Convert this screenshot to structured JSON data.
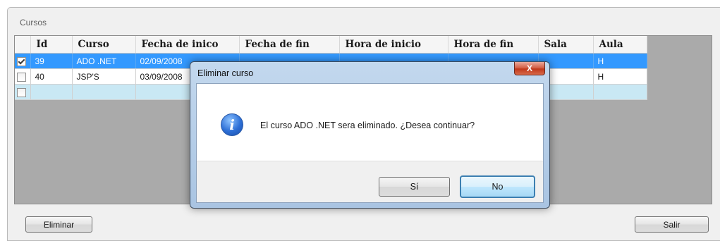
{
  "window": {
    "group_label": "Cursos"
  },
  "table": {
    "columns": [
      "Id",
      "Curso",
      "Fecha de inico",
      "Fecha de fin",
      "Hora de inicio",
      "Hora de fin",
      "Sala",
      "Aula"
    ],
    "rows": [
      {
        "checked": true,
        "id": "39",
        "curso": "ADO .NET",
        "fecha_inicio": "02/09/2008",
        "aula": "H",
        "selected": true
      },
      {
        "checked": false,
        "id": "40",
        "curso": "JSP'S",
        "fecha_inicio": "03/09/2008",
        "aula": "H",
        "selected": false
      }
    ]
  },
  "buttons": {
    "eliminar": "Eliminar",
    "salir": "Salir"
  },
  "dialog": {
    "title": "Eliminar curso",
    "close_glyph": "X",
    "icon": "info-icon",
    "icon_glyph": "i",
    "message": "El curso ADO .NET sera eliminado. ¿Desea continuar?",
    "yes_label": "Sí",
    "no_label": "No"
  },
  "colors": {
    "selection": "#3399ff",
    "new_row": "#c9e8f4"
  }
}
